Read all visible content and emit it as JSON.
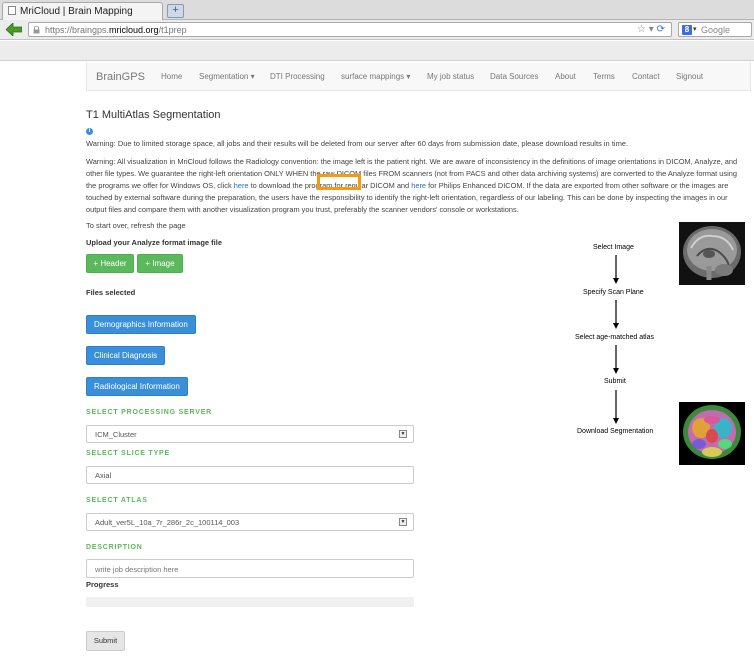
{
  "browser": {
    "tab_title": "MriCloud | Brain Mapping",
    "newtab_label": "+",
    "url_prefix": "https://braingps.",
    "url_host": "mricloud.org",
    "url_path": "/t1prep",
    "search_engine_letter": "8",
    "search_placeholder": "Google"
  },
  "nav": {
    "brand": "BrainGPS",
    "items": [
      "Home",
      "Segmentation ▾",
      "DTI Processing",
      "surface mappings ▾",
      "My job status",
      "Data Sources",
      "About",
      "Terms",
      "Contact",
      "Signout"
    ]
  },
  "page": {
    "title": "T1 MultiAtlas Segmentation",
    "warning1": "Warning: Due to limited storage space, all jobs and their results will be deleted from our server after 60 days from submission date, please download results in time.",
    "warning2_part1": "Warning: All visualization in MriCloud follows the Radiology convention: the image left is the patient right. We are aware of inconsistency in the definitions of image orientations in DICOM, Analyze, and other file types. We guarantee the right-left orientation ONLY WHEN the raw DICOM files FROM scanners (not from PACS and other data archiving systems) are converted to the Analyze format using the programs we offer for Windows OS, click ",
    "warning2_link1": "here",
    "warning2_part2": " to download the program for regular DICOM and ",
    "warning2_link2": "here",
    "warning2_part3": " for Philips Enhanced DICOM. If the data are exported from other software or the images are touched by external software during the preparation, the users have the responsibility to identify the right-left orientation, regardless of our labeling. This can be done by inspecting the images in our output files and compare them with another visualization program you trust, preferably the scanner vendors' console or workstations.",
    "restart_text": "To start over, refresh the page",
    "upload_label": "Upload your Analyze format image file",
    "header_button": "+ Header",
    "image_button": "+ Image",
    "files_selected": "Files selected",
    "demographics_button": "Demographics Information",
    "clinical_button": "Clinical Diagnosis",
    "radiological_button": "Radiological Information",
    "server_label": "SELECT PROCESSING SERVER",
    "server_value": "ICM_Cluster",
    "slice_label": "SELECT SLICE TYPE",
    "slice_value": "Axial",
    "atlas_label": "SELECT ATLAS",
    "atlas_value": "Adult_ver5L_10a_7r_286r_2c_100114_003",
    "description_label": "DESCRIPTION",
    "description_placeholder": "write job description here",
    "progress_label": "Progress",
    "progress_value": 0,
    "submit_button": "Submit"
  },
  "workflow": {
    "steps": [
      "Select Image",
      "Specify Scan Plane",
      "Select age-matched atlas",
      "Submit",
      "Download Segmentation"
    ]
  },
  "colors": {
    "green": "#5cb85c",
    "blue": "#3a8fd9",
    "highlight": "#f39c12",
    "link": "#2a6ebb"
  }
}
